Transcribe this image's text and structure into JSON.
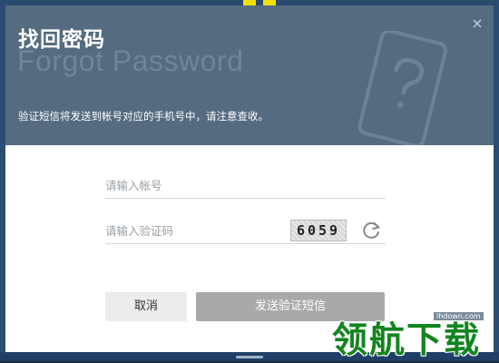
{
  "dialog": {
    "title_cn": "找回密码",
    "title_en": "Forgot Password",
    "hint": "验证短信将发送到帐号对应的手机号中，请注意查收。",
    "close_symbol": "×"
  },
  "form": {
    "account_placeholder": "请输入帐号",
    "code_placeholder": "请输入验证码",
    "captcha_text": "6059"
  },
  "buttons": {
    "cancel_label": "取消",
    "send_label": "发送验证短信"
  },
  "watermark": {
    "text": "领航下载",
    "url": "lhdown.com"
  },
  "colors": {
    "header_bg": "#546b80",
    "send_button_bg": "#a9a9a9",
    "cancel_button_bg": "#ececec",
    "watermark_green": "#13851f"
  },
  "icons": {
    "close": "close-icon",
    "refresh": "refresh-icon",
    "phone": "phone-question-icon"
  }
}
